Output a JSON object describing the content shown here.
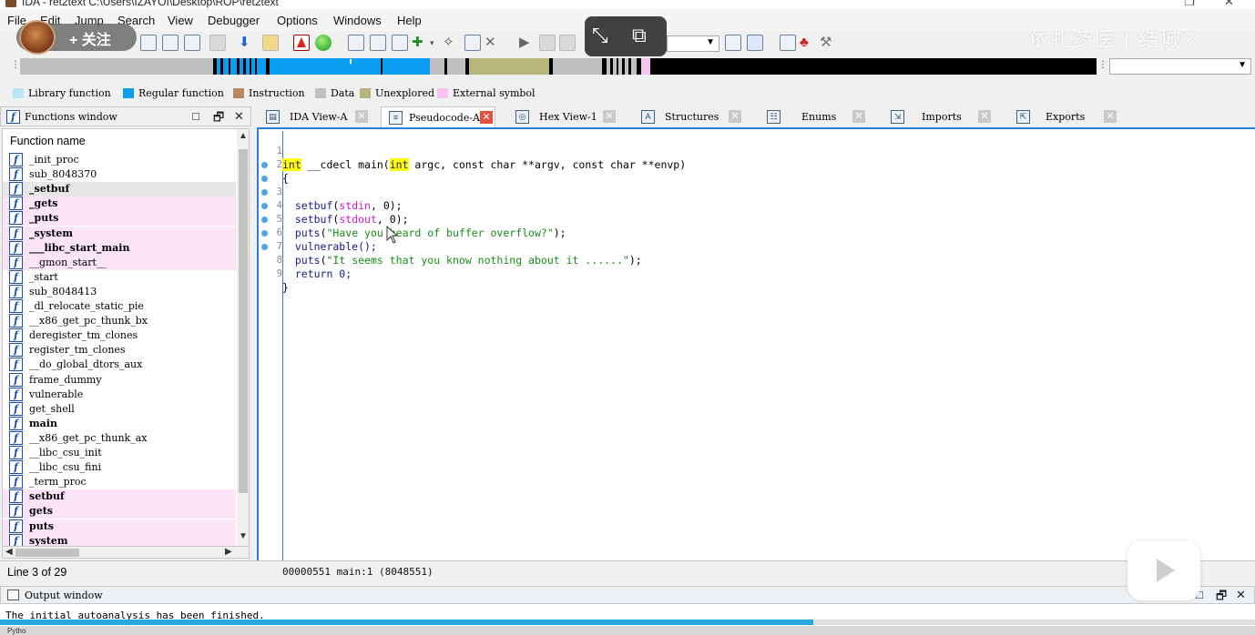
{
  "window": {
    "title": "IDA - ret2text C:\\Users\\IZAYOI\\Desktop\\ROP\\ret2text"
  },
  "menu": [
    "File",
    "Edit",
    "Jump",
    "Search",
    "View",
    "Debugger",
    "Options",
    "Windows",
    "Help"
  ],
  "overlay": {
    "follow_label": "+ 关注",
    "watermark": "依扎药医 | 结城?",
    "play_icon": "play-icon"
  },
  "navband": {
    "colors": {
      "library": "#b8e6f6",
      "regular": "#0a9ef0",
      "instruction": "#b98860",
      "data": "#c0c0c0",
      "unexplored": "#b6b67c",
      "external": "#f6c2f0",
      "black": "#000000"
    }
  },
  "legend": [
    {
      "label": "Library function",
      "color": "#b8e6f6"
    },
    {
      "label": "Regular function",
      "color": "#0a9ef0"
    },
    {
      "label": "Instruction",
      "color": "#b98860"
    },
    {
      "label": "Data",
      "color": "#c0c0c0"
    },
    {
      "label": "Unexplored",
      "color": "#b6b67c"
    },
    {
      "label": "External symbol",
      "color": "#f6c2f0"
    }
  ],
  "functions_window": {
    "title": "Functions window",
    "column": "Function name",
    "items": [
      {
        "name": "_init_proc",
        "style": "normal"
      },
      {
        "name": "sub_8048370",
        "style": "normal"
      },
      {
        "name": "_setbuf",
        "style": "selected"
      },
      {
        "name": "_gets",
        "style": "ext"
      },
      {
        "name": "_puts",
        "style": "ext"
      },
      {
        "name": "_system",
        "style": "ext"
      },
      {
        "name": "___libc_start_main",
        "style": "ext"
      },
      {
        "name": "__gmon_start__",
        "style": "ext-normal"
      },
      {
        "name": "_start",
        "style": "normal"
      },
      {
        "name": "sub_8048413",
        "style": "normal"
      },
      {
        "name": "_dl_relocate_static_pie",
        "style": "normal"
      },
      {
        "name": "__x86_get_pc_thunk_bx",
        "style": "normal"
      },
      {
        "name": "deregister_tm_clones",
        "style": "normal"
      },
      {
        "name": "register_tm_clones",
        "style": "normal"
      },
      {
        "name": "__do_global_dtors_aux",
        "style": "normal"
      },
      {
        "name": "frame_dummy",
        "style": "normal"
      },
      {
        "name": "vulnerable",
        "style": "normal"
      },
      {
        "name": "get_shell",
        "style": "normal"
      },
      {
        "name": "main",
        "style": "bold"
      },
      {
        "name": "__x86_get_pc_thunk_ax",
        "style": "normal"
      },
      {
        "name": "__libc_csu_init",
        "style": "normal"
      },
      {
        "name": "__libc_csu_fini",
        "style": "normal"
      },
      {
        "name": "_term_proc",
        "style": "normal"
      },
      {
        "name": "setbuf",
        "style": "ext"
      },
      {
        "name": "gets",
        "style": "ext"
      },
      {
        "name": "puts",
        "style": "ext"
      },
      {
        "name": "system",
        "style": "ext"
      }
    ]
  },
  "tabs": [
    {
      "label": "IDA View-A",
      "icon": "graph-view-icon",
      "active": false
    },
    {
      "label": "Pseudocode-A",
      "icon": "pseudocode-icon",
      "active": true
    },
    {
      "label": "Hex View-1",
      "icon": "hex-view-icon",
      "active": false
    },
    {
      "label": "Structures",
      "icon": "structures-icon",
      "active": false
    },
    {
      "label": "Enums",
      "icon": "enums-icon",
      "active": false
    },
    {
      "label": "Imports",
      "icon": "imports-icon",
      "active": false
    },
    {
      "label": "Exports",
      "icon": "exports-icon",
      "active": false
    }
  ],
  "code": {
    "lines": [
      {
        "no": "1",
        "dot": false,
        "text": "int __cdecl main(int argc, const char **argv, const char **envp)"
      },
      {
        "no": "2",
        "dot": false,
        "text": "{"
      },
      {
        "no": "3",
        "dot": true,
        "text": "  setbuf(stdin, 0);"
      },
      {
        "no": "4",
        "dot": true,
        "text": "  setbuf(stdout, 0);"
      },
      {
        "no": "5",
        "dot": true,
        "text": "  puts(\"Have you heard of buffer overflow?\");"
      },
      {
        "no": "6",
        "dot": true,
        "text": "  vulnerable();"
      },
      {
        "no": "7",
        "dot": true,
        "text": "  puts(\"It seems that you know nothing about it ......\");"
      },
      {
        "no": "8",
        "dot": true,
        "text": "  return 0;"
      },
      {
        "no": "9",
        "dot": true,
        "text": "}"
      }
    ]
  },
  "status": {
    "line_info": "Line 3 of 29",
    "address": "00000551 main:1 (8048551)"
  },
  "output_window": {
    "title": "Output window",
    "message": "The initial autoanalysis has been finished."
  },
  "bottom_strip": {
    "label": "Pytho"
  },
  "video": {
    "progress_fraction": 0.648
  }
}
